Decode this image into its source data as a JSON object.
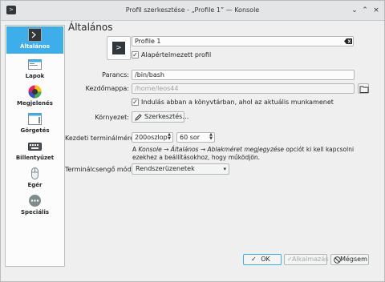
{
  "window": {
    "title": "Profil szerkesztése - „Profile 1” — Konsole"
  },
  "sidebar": {
    "items": [
      {
        "label": "Általános",
        "icon": "terminal-icon",
        "active": true
      },
      {
        "label": "Lapok",
        "icon": "tabs-icon",
        "active": false
      },
      {
        "label": "Megjelenés",
        "icon": "color-palette-icon",
        "active": false
      },
      {
        "label": "Görgetés",
        "icon": "scrolling-icon",
        "active": false
      },
      {
        "label": "Billentyűzet",
        "icon": "keyboard-icon",
        "active": false
      },
      {
        "label": "Egér",
        "icon": "mouse-icon",
        "active": false
      },
      {
        "label": "Speciális",
        "icon": "more-icon",
        "active": false
      }
    ]
  },
  "main": {
    "heading": "Általános",
    "profile_name": {
      "value": "Profile 1"
    },
    "default_profile": {
      "label": "Alapértelmezett profil",
      "checked": true
    },
    "command": {
      "label": "Parancs:",
      "value": "/bin/bash"
    },
    "start_dir": {
      "label": "Kezdőmappa:",
      "value": "/home/leos44"
    },
    "start_in_current": {
      "label": "Indulás abban a könyvtárban, ahol az aktuális munkamenet",
      "checked": true
    },
    "environment": {
      "label": "Környezet:",
      "button": "Szerkesztés…"
    },
    "terminal_size": {
      "label": "Kezdeti terminálméret:",
      "columns": "200oszlop",
      "rows": "60 sor"
    },
    "size_note": {
      "prefix": "A ",
      "path_a": "Konsole",
      "arrow1": " → ",
      "path_b": "Általános",
      "arrow2": " → ",
      "path_c": "Ablakméret megjegyzése",
      "suffix": " opciót ki kell kapcsolni ezekhez a beállításokhoz, hogy működjön."
    },
    "bell_mode": {
      "label": "Terminálcsengő mód:",
      "value": "Rendszerüzenetek"
    }
  },
  "buttons": {
    "ok": "OK",
    "apply": "Alkalmazás",
    "cancel": "Mégsem"
  },
  "colors": {
    "accent": "#3daee9",
    "text": "#232629",
    "window": "#efefef"
  }
}
